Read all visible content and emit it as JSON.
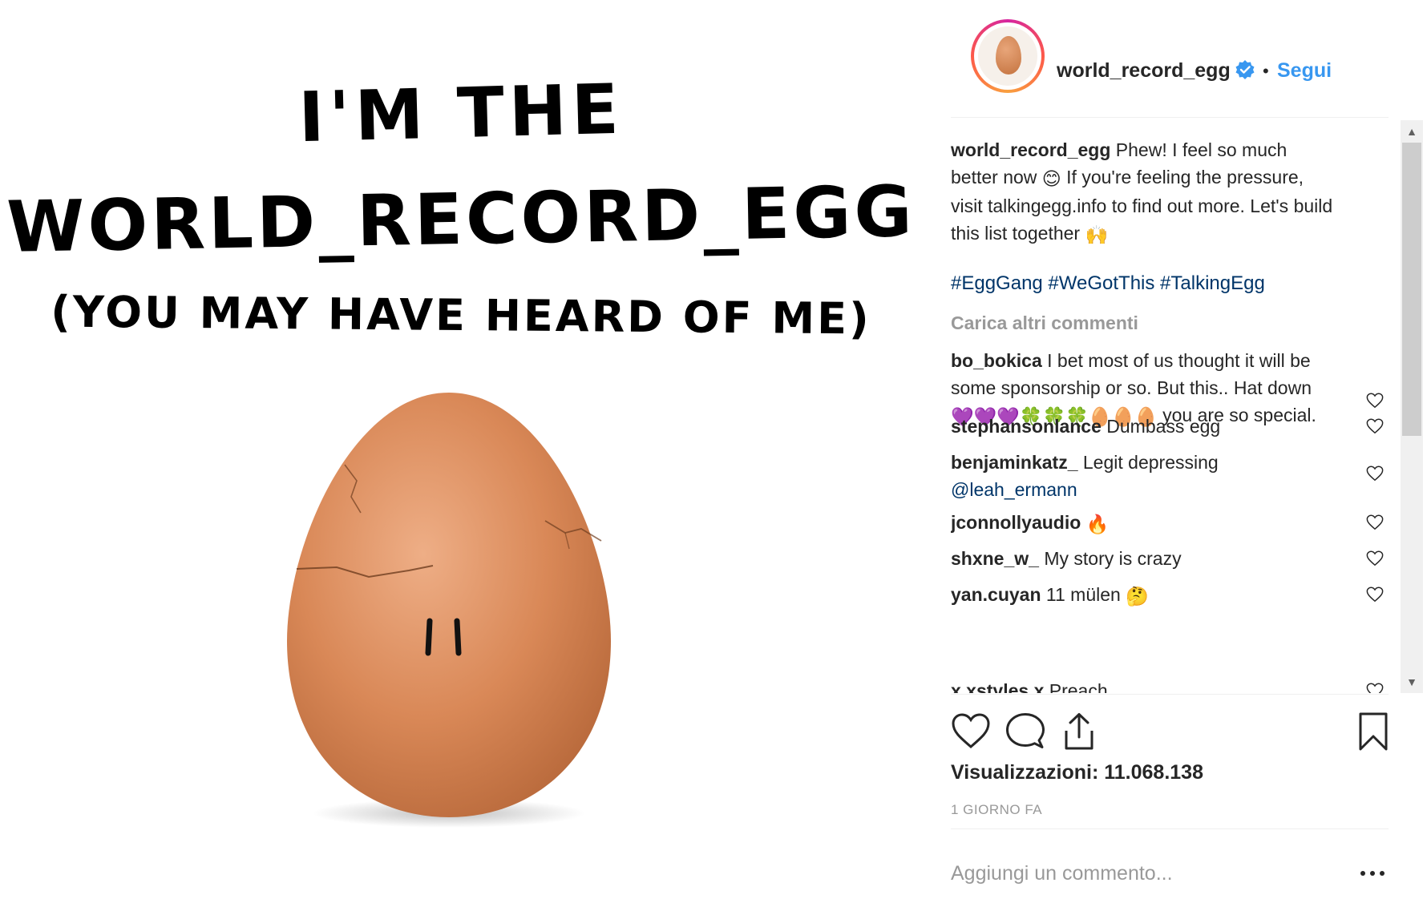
{
  "media": {
    "line1": "I'M THE",
    "line2": "WORLD_RECORD_EGG",
    "line3": "(YOU MAY HAVE HEARD OF ME)"
  },
  "header": {
    "username": "world_record_egg",
    "dot": "•",
    "follow_label": "Segui"
  },
  "caption": {
    "username": "world_record_egg",
    "text_a": "Phew! I feel so much better now",
    "emoji_a": "😊",
    "text_b": "If you're feeling the pressure, visit talkingegg.info to find out more. Let's build this list together",
    "emoji_b": "🙌",
    "hashtags": "#EggGang #WeGotThis #TalkingEgg"
  },
  "load_more_label": "Carica altri commenti",
  "comments": [
    {
      "username": "bo_bokica",
      "text": "I bet most of us thought it will be some sponsorship or so. But this.. Hat down",
      "emojis": "💜💜💜🍀🍀🍀🥚🥚🥚",
      "tail": "you are so special."
    },
    {
      "username": "stephansonlance",
      "text": "Dumbass egg"
    },
    {
      "username": "benjaminkatz_",
      "text": "Legit depressing",
      "mention": "@leah_ermann"
    },
    {
      "username": "jconnollyaudio",
      "text": "🔥"
    },
    {
      "username": "shxne_w_",
      "text": "My story is crazy"
    },
    {
      "username": "yan.cuyan",
      "text": "11 mülen",
      "emoji": "🤔"
    },
    {
      "username": "x.xstyles.x",
      "text": "Preach"
    }
  ],
  "stats": {
    "views": "Visualizzazioni: 11.068.138",
    "timestamp": "1 GIORNO FA"
  },
  "comment_box": {
    "placeholder": "Aggiungi un commento..."
  },
  "colors": {
    "link": "#3897f0",
    "hashtag": "#003569",
    "muted": "#999999",
    "text": "#262626"
  }
}
